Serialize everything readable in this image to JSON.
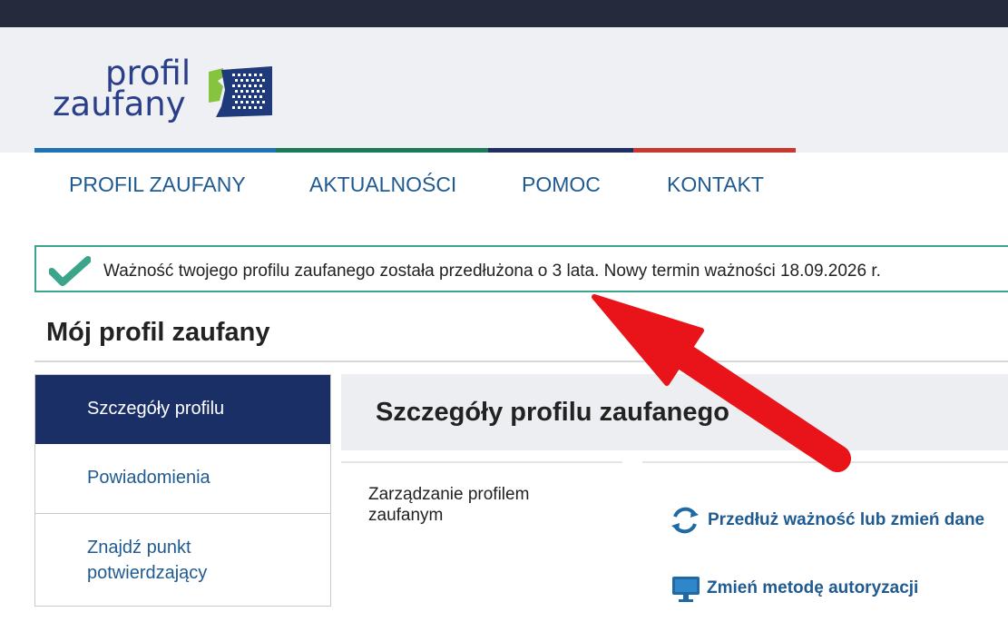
{
  "header": {
    "logo_line1": "profil",
    "logo_line2": "zaufany",
    "brand_colors": [
      "#1e73b7",
      "#1a7a5a",
      "#1f2f63",
      "#c8382c"
    ]
  },
  "nav": {
    "items": [
      {
        "label": "PROFIL ZAUFANY"
      },
      {
        "label": "AKTUALNOŚCI"
      },
      {
        "label": "POMOC"
      },
      {
        "label": "KONTAKT"
      }
    ]
  },
  "alert": {
    "icon": "check-icon",
    "text": "Ważność twojego profilu zaufanego została przedłużona o 3 lata. Nowy termin ważności 18.09.2026 r.",
    "color": "#3aa58a"
  },
  "page": {
    "title": "Mój profil zaufany"
  },
  "sidebar": {
    "items": [
      {
        "label": "Szczegóły profilu"
      },
      {
        "label": "Powiadomienia"
      },
      {
        "label": "Znajdź punkt potwierdzający"
      }
    ]
  },
  "panel": {
    "title": "Szczegóły profilu zaufanego",
    "manage_label": "Zarządzanie profilem zaufanym",
    "actions": [
      {
        "label": "Przedłuż ważność lub zmień dane",
        "icon": "refresh-icon"
      },
      {
        "label": "Zmień metodę autoryzacji",
        "icon": "monitor-icon"
      }
    ]
  },
  "annotation": {
    "arrow_color": "#e8141a"
  }
}
